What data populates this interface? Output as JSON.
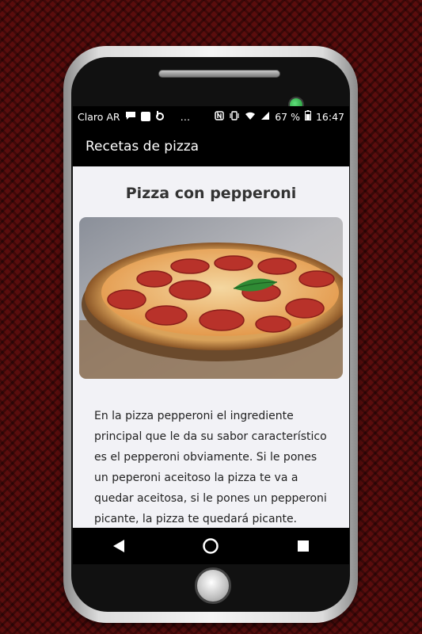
{
  "status_bar": {
    "carrier": "Claro AR",
    "battery": "67 %",
    "time": "16:47",
    "dots": "…"
  },
  "app_bar": {
    "title": "Recetas de pizza"
  },
  "recipe": {
    "title": "Pizza con pepperoni",
    "image_icon": "pizza-photo",
    "description": "En la pizza pepperoni el ingrediente principal que le da su sabor característico es el pepperoni obviamente. Si le pones un peperoni aceitoso la pizza te va a quedar aceitosa, si le pones un pepperoni picante, la pizza te quedará picante."
  },
  "nav_bar": {
    "back_icon": "back-icon",
    "home_icon": "home-icon",
    "recents_icon": "recents-icon"
  },
  "colors": {
    "background": "#5a0d0d",
    "app_bar": "#000000",
    "screen_bg": "#f2f2f6",
    "camera_led": "#2fbf4a"
  }
}
